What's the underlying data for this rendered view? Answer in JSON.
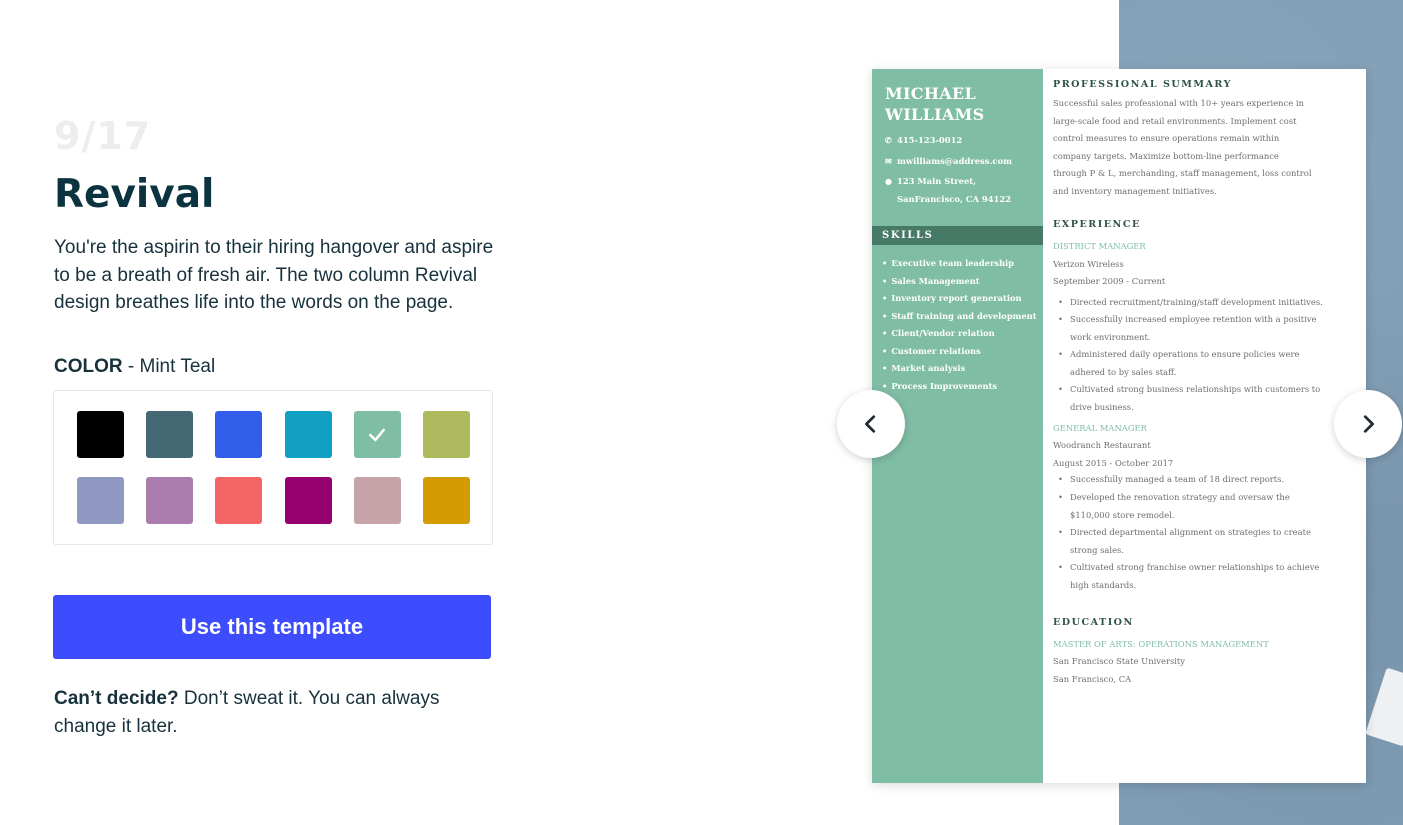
{
  "template": {
    "counter": "9/17",
    "name": "Revival",
    "description": "You're the aspirin to their hiring hangover and aspire to be a breath of fresh air. The two column Revival design breathes life into the words on the page."
  },
  "color": {
    "label": "COLOR",
    "separator": " - ",
    "selected_name": "Mint Teal",
    "swatches": [
      "#000000",
      "#446974",
      "#325de9",
      "#11a0c3",
      "#80bda5",
      "#adb95c",
      "#8f99c1",
      "#ab7daf",
      "#f66566",
      "#95026f",
      "#c6a3a9",
      "#d59c01"
    ],
    "selected_index": 4
  },
  "cta": {
    "label": "Use this template"
  },
  "note": {
    "bold": "Can’t decide?",
    "text": " Don’t sweat it. You can always change it later."
  },
  "resume": {
    "name_line1": "MICHAEL",
    "name_line2": "WILLIAMS",
    "phone": "415-123-0012",
    "email": "mwilliams@address.com",
    "address_line1": "123 Main Street,",
    "address_line2": "SanFrancisco, CA 94122",
    "skills_heading": "SKILLS",
    "skills": [
      "Executive team leadership",
      "Sales Management",
      "Inventory report generation",
      "Staff training and development",
      "Client/Vendor relation",
      "Customer relations",
      "Market analysis",
      "Process Improvements"
    ],
    "summary_heading": "PROFESSIONAL SUMMARY",
    "summary_lines": [
      "Successful sales professional with 10+ years experience in",
      "large-scale food and retail environments. Implement cost",
      "control measures to ensure operations remain within",
      "company targets. Maximize bottom-line performance",
      "through P & L, merchanding, staff management, loss control",
      "and inventory management initiatives."
    ],
    "experience_heading": "EXPERIENCE",
    "job1": {
      "title": "DISTRICT MANAGER",
      "company": "Verizon Wireless",
      "dates": "September 2009 - Current",
      "bullets": [
        [
          "Directed recruitment/training/staff development initiatives."
        ],
        [
          "Successfully increased employee retention with a positive",
          "work environment."
        ],
        [
          "Administered daily operations to ensure policies were",
          "adhered to by sales staff."
        ],
        [
          "Cultivated strong business relationships with customers to",
          "drive business."
        ]
      ]
    },
    "job2": {
      "title": "GENERAL MANAGER",
      "company": "Woodranch Restaurant",
      "dates": "August 2015 - October 2017",
      "bullets": [
        [
          "Successfully managed a team of 18 direct reports."
        ],
        [
          "Developed the renovation strategy and oversaw the",
          "$110,000 store remodel."
        ],
        [
          "Directed departmental alignment on strategies to create",
          "strong sales."
        ],
        [
          "Cultivated strong franchise owner relationships to achieve",
          "high standards."
        ]
      ]
    },
    "education_heading": "EDUCATION",
    "degree": "MASTER OF ARTS: OPERATIONS MANAGEMENT",
    "school": "San Francisco State University",
    "location": "San Francisco, CA"
  },
  "icons": {
    "prev": "chevron-left-icon",
    "next": "chevron-right-icon",
    "check": "check-icon",
    "phone": "phone-icon",
    "email": "email-icon",
    "address": "person-icon"
  }
}
